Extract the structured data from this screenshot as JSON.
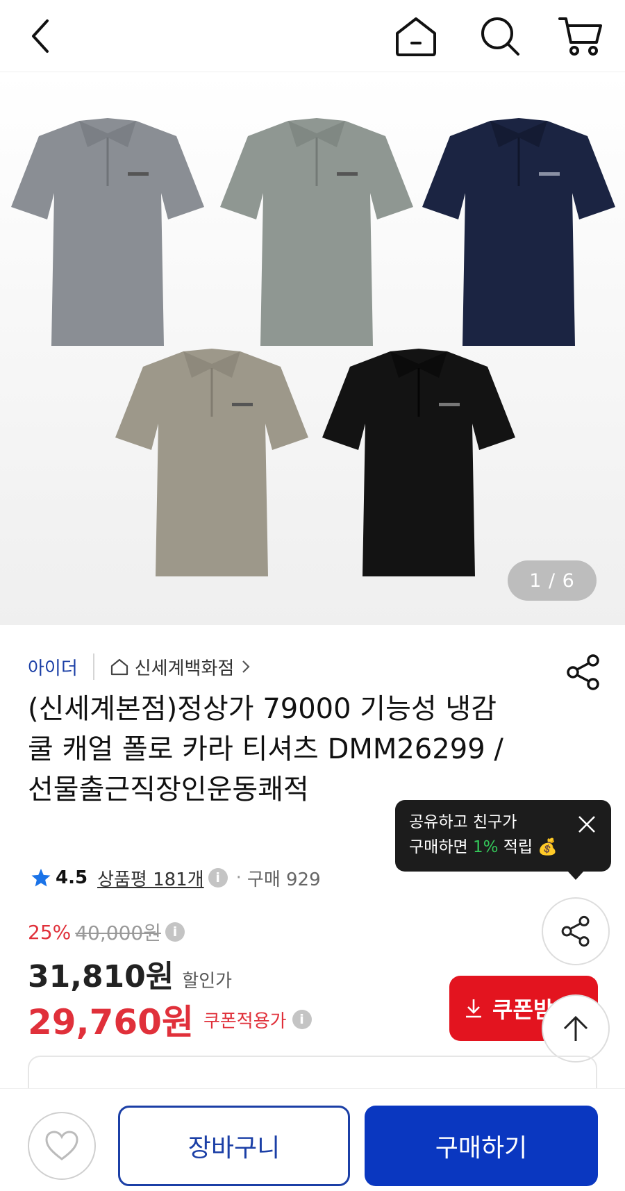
{
  "topbar": {
    "icons": [
      "back-icon",
      "home-icon",
      "search-icon",
      "cart-icon"
    ]
  },
  "gallery": {
    "page_indicator": "1 / 6",
    "shirt_colors": [
      "#8a8e94",
      "#8f9792",
      "#1b2442",
      "#9d988a",
      "#131313"
    ]
  },
  "product": {
    "brand": "아이더",
    "store": "신세계백화점",
    "title": "(신세계본점)정상가 79000 기능성 냉감 쿨 캐얼 폴로 카라 티셔츠 DMM26299 / 선물출근직장인운동쾌적",
    "rating": "4.5",
    "reviews": "상품평 181개",
    "purchases": "구매 929",
    "discount_rate": "25%",
    "original_price": "40,000원",
    "sale_price": "31,810원",
    "sale_label": "할인가",
    "coupon_price": "29,760원",
    "coupon_label": "쿠폰적용가"
  },
  "tooltip": {
    "line1": "공유하고 친구가",
    "line2_prefix": "구매하면 ",
    "line2_highlight": "1%",
    "line2_suffix": " 적립"
  },
  "buttons": {
    "coupon": "쿠폰받기",
    "cart": "장바구니",
    "buy": "구매하기"
  },
  "colors": {
    "brand_blue": "#1b3fa6",
    "buy_blue": "#0a37c0",
    "sale_red": "#e0303a"
  }
}
